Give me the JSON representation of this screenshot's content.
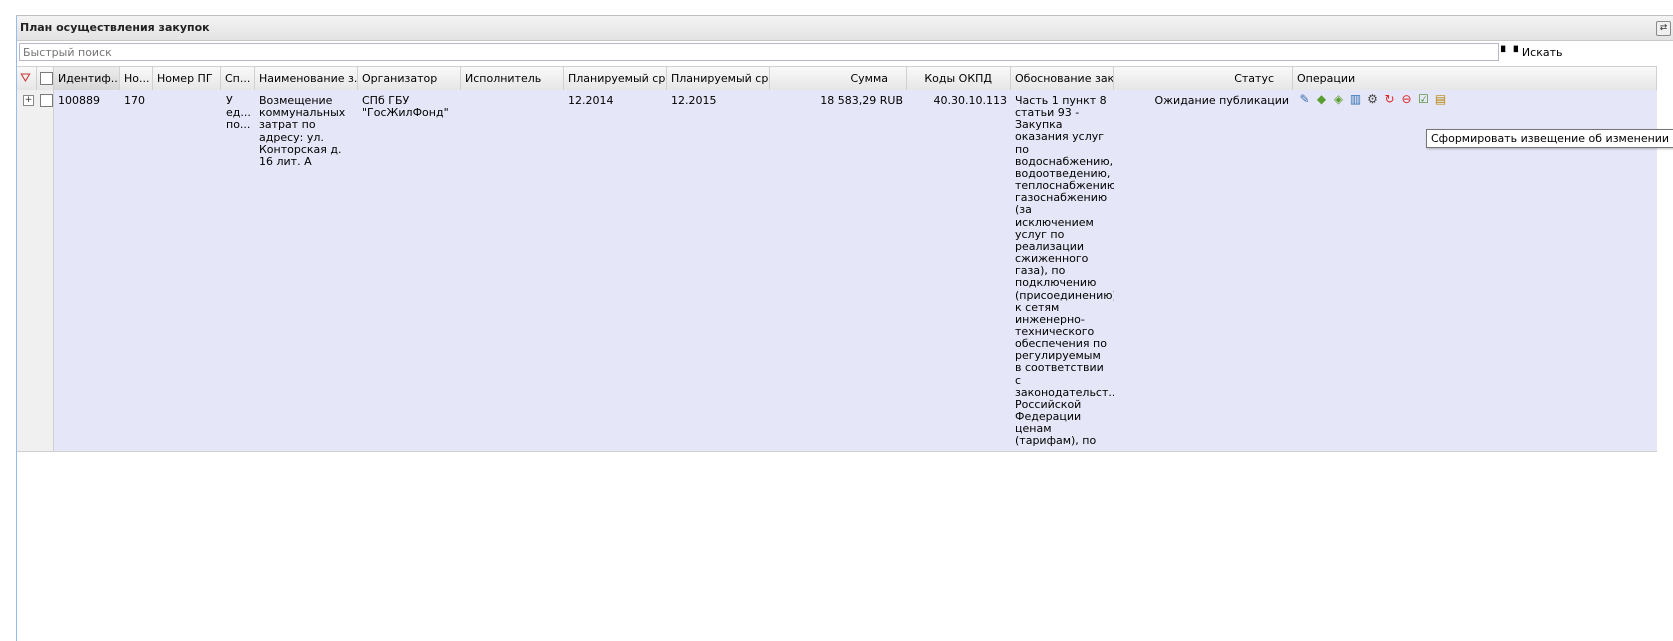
{
  "panel": {
    "title": "План осуществления закупок",
    "tool_icon": "refresh-icon"
  },
  "search": {
    "placeholder": "Быстрый поиск",
    "button_label": "Искать",
    "button_icon": "binoculars-icon"
  },
  "grid": {
    "columns": [
      "Идентиф...",
      "Но...",
      "Номер ПГ",
      "Сп...",
      "Наименование з...",
      "Организатор",
      "Исполнитель",
      "Планируемый ср...",
      "Планируемый ср...",
      "Сумма",
      "Коды ОКПД",
      "Обоснование зак...",
      "Статус",
      "Операции"
    ],
    "rows": [
      {
        "id": "100889",
        "num": "170",
        "pg_number": "",
        "method": "У ед... по...",
        "name": "Возмещение коммунальных затрат по адресу: ул. Конторская д. 16 лит. А",
        "organizer": "СПб ГБУ \"ГосЖилФонд\"",
        "executor": "",
        "planned_start": "12.2014",
        "planned_end": "12.2015",
        "amount": "18 583,29 RUB",
        "okpd": "40.30.10.113",
        "justification": "Часть 1 пункт 8 статьи 93 - Закупка оказания услуг по водоснабжению, водоотведению, теплоснабжению, газоснабжению (за исключением услуг по реализации сжиженного газа), по подключению (присоединению) к сетям инженерно-технического обеспечения по регулируемым в соответствии с законодательст... Российской Федерации ценам (тарифам), по хранению и ввозу (вывозу) наркотических средств и психотропных веществ",
        "status": "Ожидание публикации"
      }
    ],
    "operations": [
      "edit-pencil-icon",
      "approve-icon",
      "approve-all-icon",
      "chart-icon",
      "settings-gears-icon",
      "refresh-red-icon",
      "cancel-icon",
      "notice-change-icon",
      "archive-icon"
    ]
  },
  "tooltip": {
    "text": "Сформировать извещение об изменении"
  },
  "colors": {
    "row_bg": "#e5e6f7",
    "header_bg": "#e6e6e6"
  }
}
